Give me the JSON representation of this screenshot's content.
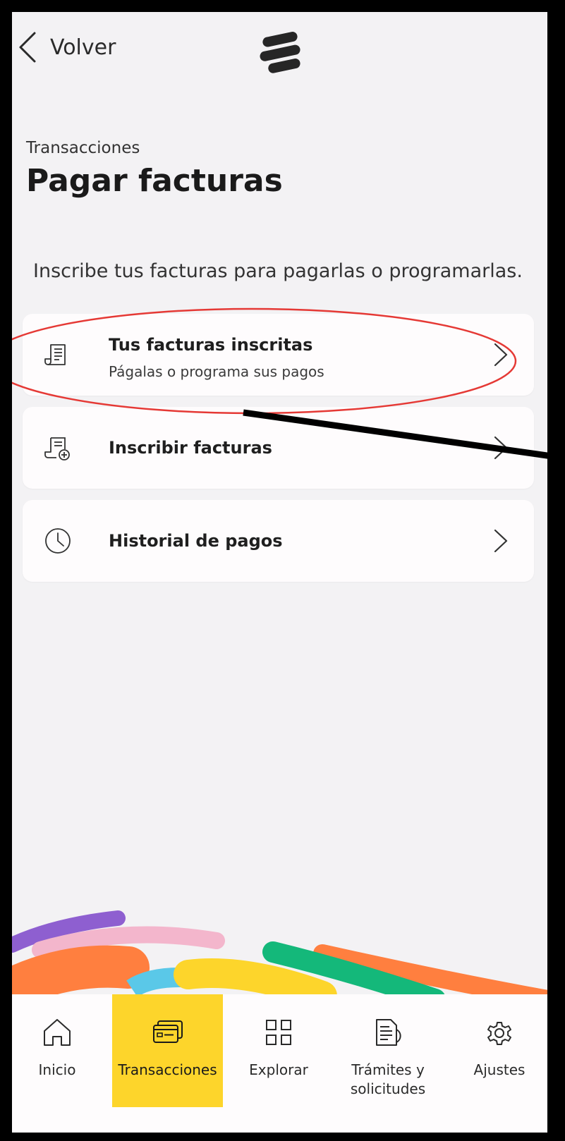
{
  "header": {
    "back_label": "Volver"
  },
  "page": {
    "eyebrow": "Transacciones",
    "title": "Pagar facturas",
    "intro": "Inscribe tus facturas para pagarlas o programarlas."
  },
  "options": [
    {
      "title": "Tus facturas inscritas",
      "subtitle": "Págalas o programa sus pagos",
      "icon": "receipt-icon"
    },
    {
      "title": "Inscribir facturas",
      "icon": "receipt-add-icon"
    },
    {
      "title": "Historial de pagos",
      "icon": "clock-icon"
    }
  ],
  "nav": {
    "items": [
      {
        "label": "Inicio",
        "icon": "home-icon"
      },
      {
        "label": "Transacciones",
        "icon": "cards-icon",
        "active": true
      },
      {
        "label": "Explorar",
        "icon": "grid-icon"
      },
      {
        "label_line1": "Trámites y",
        "label_line2": "solicitudes",
        "icon": "document-icon"
      },
      {
        "label": "Ajustes",
        "icon": "gear-icon"
      }
    ]
  },
  "colors": {
    "background": "#f3f2f4",
    "card": "#fefcfd",
    "active_tab": "#fdd52b",
    "annotation_red": "#e53935",
    "ribbon_purple": "#8e5fd0",
    "ribbon_pink": "#f3b6cc",
    "ribbon_orange": "#ff7f3f",
    "ribbon_cyan": "#5ac8e8",
    "ribbon_yellow": "#fdd52b",
    "ribbon_green": "#14b87a"
  }
}
